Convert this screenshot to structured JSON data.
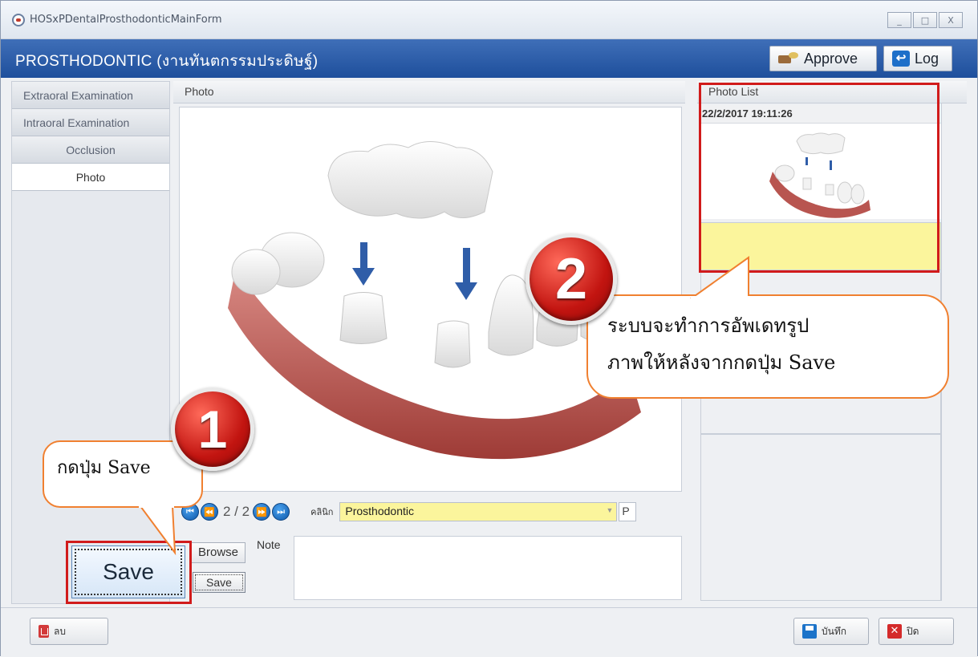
{
  "window": {
    "title": "HOSxPDentalProsthodonticMainForm",
    "controls": [
      "_",
      "□",
      "X"
    ]
  },
  "header": {
    "module_title": "PROSTHODONTIC (งานทันตกรรมประดิษฐ์)",
    "approve_label": "Approve",
    "log_label": "Log"
  },
  "leftnav": {
    "items": [
      {
        "label": "Extraoral Examination"
      },
      {
        "label": "Intraoral Examination"
      },
      {
        "label": "Occlusion"
      },
      {
        "label": "Photo"
      }
    ]
  },
  "photo_panel": {
    "header": "Photo",
    "page_indicator": "2 / 2",
    "nav_first": "⏮",
    "nav_prev": "⏪",
    "nav_next": "⏩",
    "nav_last": "⏭",
    "clinic_label": "คลินิก",
    "clinic_value": "Prosthodontic",
    "clinic_extra": "P",
    "browse_label": "Browse",
    "save_small_label": "Save",
    "note_label": "Note",
    "note_value": ""
  },
  "photo_list": {
    "header": "Photo List",
    "date": "22/2/2017 19:11:26",
    "note_value": ""
  },
  "annotations": {
    "badge_1": "1",
    "badge_2": "2",
    "callout_1": "กดปุ่ม Save",
    "callout_2_line1": "ระบบจะทำการอัพเดทรูป",
    "callout_2_line2": "ภาพให้หลังจากกดปุ่ม Save",
    "save_big_label": "Save"
  },
  "footer": {
    "delete_label": "ลบ",
    "save_label": "บันทึก",
    "close_label": "ปิด"
  },
  "colors": {
    "header_blue": "#1e4f9c",
    "highlight_red": "#d11b1b",
    "callout_orange": "#f08030",
    "yellow_field": "#fbf59c"
  }
}
